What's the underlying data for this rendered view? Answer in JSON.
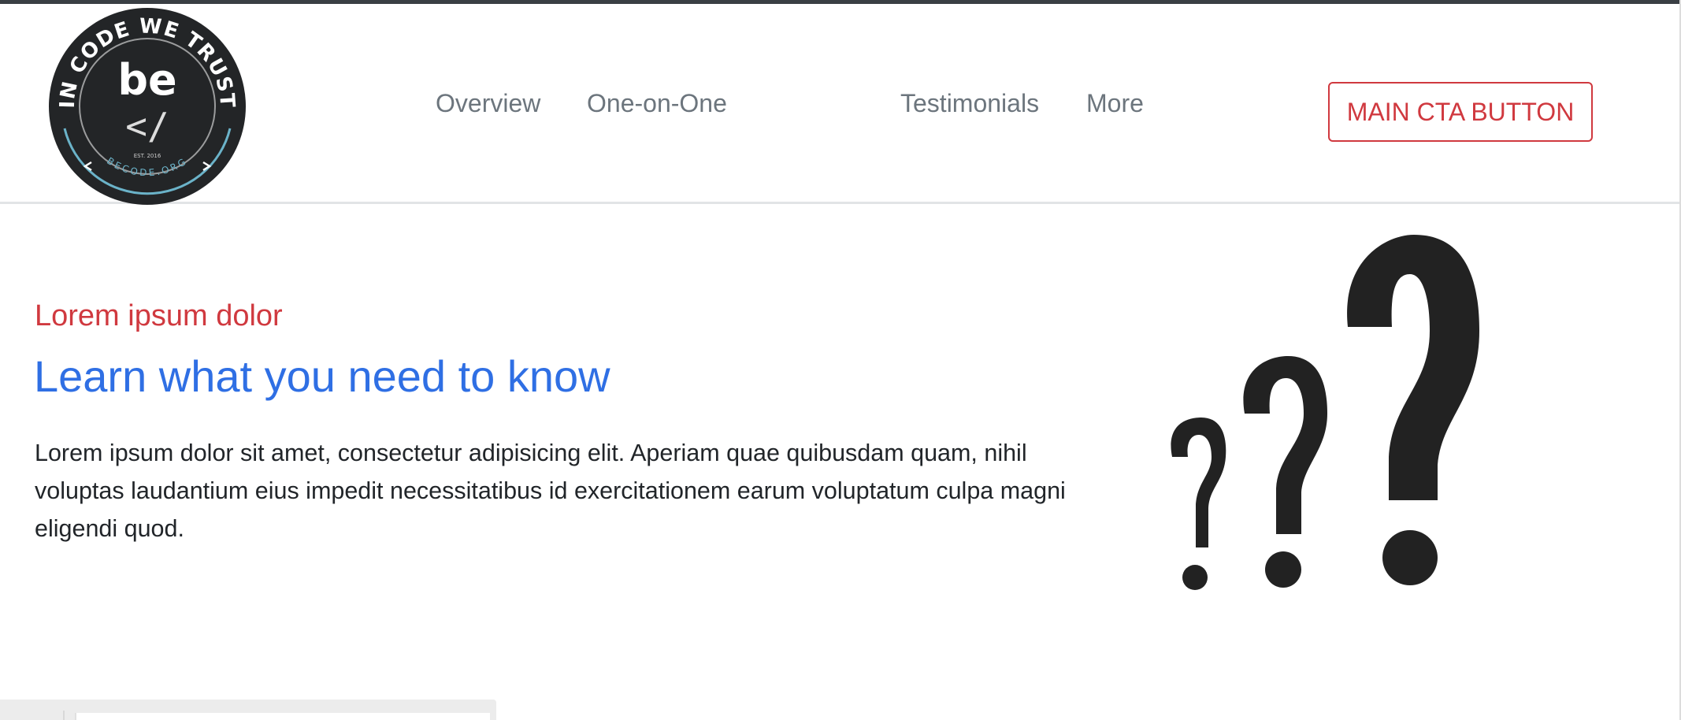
{
  "header": {
    "logo": {
      "ring_text": "IN CODE WE TRUST",
      "center_word": "be",
      "center_symbol": "</",
      "est": "EST. 2016",
      "bottom_text": "BECODE.ORG",
      "colors": {
        "badge": "#232527",
        "ring_accent": "#6bb3c9",
        "text": "#ffffff"
      }
    },
    "nav": [
      "Overview",
      "One-on-One",
      "Testimonials",
      "More"
    ],
    "cta_label": "MAIN CTA BUTTON"
  },
  "hero": {
    "eyebrow": "Lorem ipsum dolor",
    "title": "Learn what you need to know",
    "body": "Lorem ipsum dolor sit amet, consectetur adipisicing elit. Aperiam quae quibusdam quam, nihil voluptas laudantium eius impedit necessitatibus id exercitationem earum voluptatum culpa magni eligendi quod.",
    "illustration": "question-marks-icon"
  },
  "colors": {
    "accent_red": "#d0393f",
    "accent_blue": "#2f6fe4",
    "nav_text": "#6c757d",
    "body_text": "#212529"
  }
}
